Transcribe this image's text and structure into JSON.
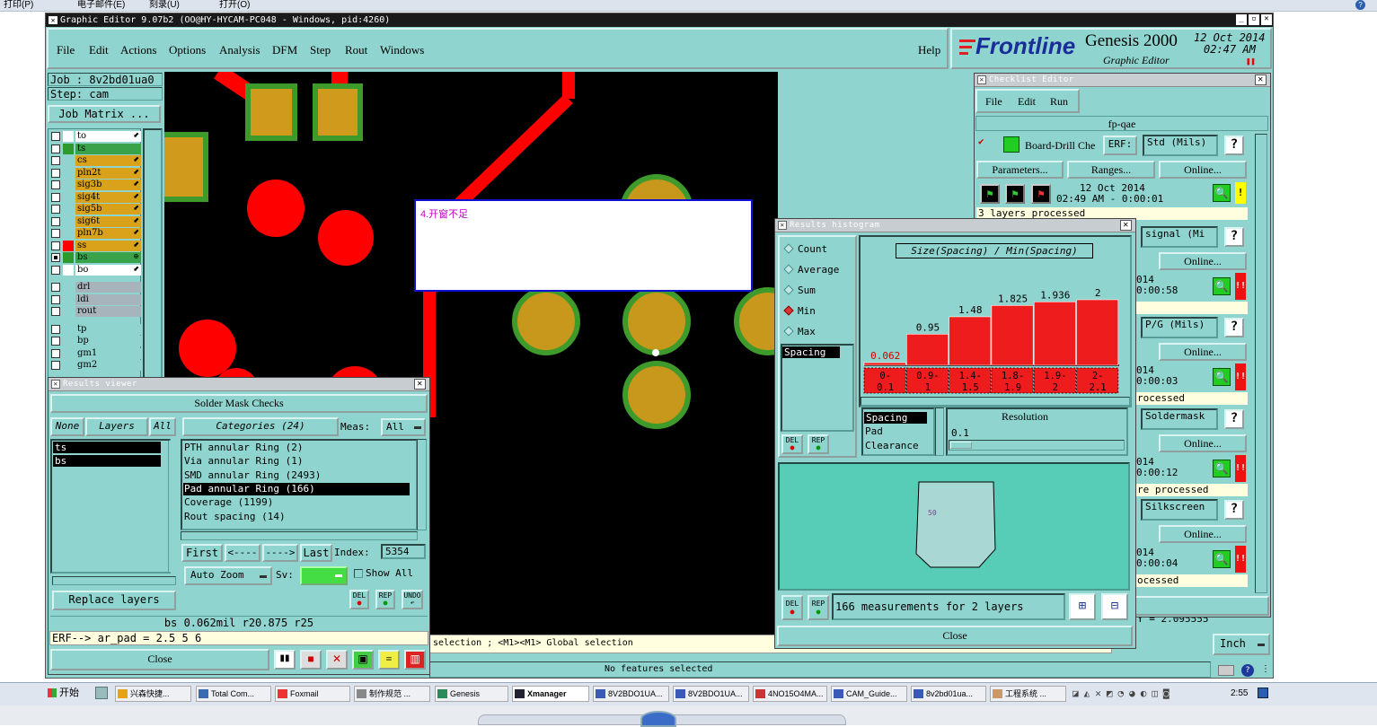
{
  "topbar": {
    "left_items": [
      "打印(P)",
      "电子邮件(E)",
      "刻录(U)",
      "打开(O)"
    ]
  },
  "window": {
    "title": "Graphic Editor 9.07b2 (OO@HY-HYCAM-PC048 - Windows, pid:4260)"
  },
  "menu": [
    "File",
    "Edit",
    "Actions",
    "Options",
    "Analysis",
    "DFM",
    "Step",
    "Rout",
    "Windows"
  ],
  "help": "Help",
  "brand": {
    "logo": "Frontline",
    "product": "Genesis 2000",
    "sub": "Graphic Editor",
    "date": "12 Oct 2014",
    "time": "02:47 AM"
  },
  "job": {
    "job_line": "Job : 8v2bd01ua0",
    "step_line": "Step: cam",
    "matrix": "Job Matrix ..."
  },
  "layers": [
    {
      "name": "to",
      "color": "#ffffff",
      "swatch": "#ffffff"
    },
    {
      "name": "ts",
      "color": "#3aa24a",
      "swatch": "#2e9a2e"
    },
    {
      "name": "cs",
      "color": "#d9a21a",
      "swatch": "#8fd4cf"
    },
    {
      "name": "pln2t",
      "color": "#d9a21a",
      "swatch": "#8fd4cf"
    },
    {
      "name": "sig3b",
      "color": "#d9a21a",
      "swatch": "#8fd4cf"
    },
    {
      "name": "sig4t",
      "color": "#d9a21a",
      "swatch": "#8fd4cf"
    },
    {
      "name": "sig5b",
      "color": "#d9a21a",
      "swatch": "#8fd4cf"
    },
    {
      "name": "sig6t",
      "color": "#d9a21a",
      "swatch": "#8fd4cf"
    },
    {
      "name": "pln7b",
      "color": "#d9a21a",
      "swatch": "#8fd4cf"
    },
    {
      "name": "ss",
      "color": "#d9a21a",
      "swatch": "#ff0000"
    },
    {
      "name": "bs",
      "color": "#3aa24a",
      "swatch": "#2e9a2e"
    },
    {
      "name": "bo",
      "color": "#ffffff",
      "swatch": "#ffffff"
    },
    {
      "name": "drl",
      "color": "#a8b4bc",
      "swatch": "#8fd4cf"
    },
    {
      "name": "ldi",
      "color": "#a8b4bc",
      "swatch": "#8fd4cf"
    },
    {
      "name": "rout",
      "color": "#a8b4bc",
      "swatch": "#8fd4cf"
    },
    {
      "name": "tp",
      "color": "#8fd4cf",
      "swatch": "#8fd4cf"
    },
    {
      "name": "bp",
      "color": "#8fd4cf",
      "swatch": "#8fd4cf"
    },
    {
      "name": "gm1",
      "color": "#8fd4cf",
      "swatch": "#8fd4cf"
    },
    {
      "name": "gm2",
      "color": "#8fd4cf",
      "swatch": "#8fd4cf"
    }
  ],
  "annotation": {
    "text": "4.开窗不足"
  },
  "results_viewer": {
    "title": "Results viewer",
    "heading": "Solder Mask Checks",
    "none": "None",
    "layers": "Layers",
    "all": "All",
    "categories_label": "Categories (24)",
    "meas_label": "Meas:",
    "meas_value": "All",
    "layer_items": [
      "ts",
      "bs"
    ],
    "category_items": [
      "PTH annular Ring (2)",
      "Via annular Ring (1)",
      "SMD annular Ring (2493)",
      "Pad annular Ring (166)",
      "Coverage (1199)",
      "Rout spacing (14)"
    ],
    "selected_category": 3,
    "first": "First",
    "prev": "<----",
    "next": "---->",
    "last": "Last",
    "index_label": "Index:",
    "index_value": "5354",
    "auto_zoom": "Auto Zoom",
    "sv": "Sv:",
    "show_all": "Show All",
    "replace_layers": "Replace layers",
    "del": "DEL",
    "rep": "REP",
    "undo": "UNDO",
    "status": "bs 0.062mil    r20.875  r25",
    "erf": "ERF--> ar_pad = 2.5 5 6",
    "close": "Close"
  },
  "checklist": {
    "title": "Checklist Editor",
    "menu": [
      "File",
      "Edit",
      "Run"
    ],
    "name": "fp-qae",
    "erf_label": "ERF:",
    "rows": [
      {
        "name": "Board-Drill Che",
        "erf": "Std (Mils)",
        "date": "12 Oct 2014",
        "time": "02:49 AM - 0:00:01",
        "status": "3 layers processed",
        "flag": "!"
      },
      {
        "erf": "signal (Mi",
        "date": "014",
        "time": "0:00:58",
        "status": "",
        "flag": "!!"
      },
      {
        "erf": "P/G (Mils)",
        "date": "014",
        "time": "0:00:03",
        "status": "rocessed",
        "flag": "!!"
      },
      {
        "erf": "Soldermask",
        "date": "014",
        "time": "0:00:12",
        "status": "re processed",
        "flag": "!!"
      },
      {
        "erf": "Silkscreen",
        "date": "014",
        "time": "0:00:04",
        "status": "ocessed",
        "flag": "!!"
      }
    ],
    "parameters": "Parameters...",
    "ranges": "Ranges...",
    "online": "Online...",
    "q": "?",
    "bottom_partial": "Y = 2.095555",
    "units": "Inch"
  },
  "histogram": {
    "title": "Results histogram",
    "options": [
      "Count",
      "Average",
      "Sum",
      "Min",
      "Max"
    ],
    "selected_option": "Min",
    "list_item": "Spacing",
    "heading": "Size(Spacing) / Min(Spacing)",
    "list2": [
      "Spacing",
      "Pad",
      "Clearance"
    ],
    "resolution_label": "Resolution",
    "resolution_value": "0.1",
    "summary": "166 measurements for 2 layers",
    "preview_label": "50",
    "close": "Close",
    "del": "DEL",
    "rep": "REP"
  },
  "chart_data": {
    "type": "bar",
    "title": "Size(Spacing) / Min(Spacing)",
    "categories": [
      "0-0.1",
      "0.9-1",
      "1.4-1.5",
      "1.8-1.9",
      "1.9-2",
      "2-2.1"
    ],
    "values": [
      0.062,
      0.95,
      1.48,
      1.825,
      1.936,
      2
    ],
    "value_labels": [
      "0.062",
      "0.95",
      "1.48",
      "1.825",
      "1.936",
      "2"
    ],
    "category_labels": [
      [
        "0-",
        "0.1"
      ],
      [
        "0.9-",
        "1"
      ],
      [
        "1.4-",
        "1.5"
      ],
      [
        "1.8-",
        "1.9"
      ],
      [
        "1.9-",
        "2"
      ],
      [
        "2-",
        "2.1"
      ]
    ],
    "ylim": [
      0,
      2.3
    ],
    "colors": {
      "bar": "#ee1c1c",
      "label_first": "#cc0000"
    }
  },
  "status": {
    "left_hint": "selection ; <M1><M1> Global selection",
    "center": "No features selected"
  },
  "taskbar": {
    "start": "开始",
    "items": [
      "兴森快捷...",
      "Total Com...",
      "Foxmail",
      "制作规范 ...",
      "Genesis",
      "Xmanager",
      "8V2BDO1UA...",
      "8V2BDO1UA...",
      "4NO15O4MA...",
      "CAM_Guide...",
      "8v2bd01ua...",
      "工程系统 ..."
    ],
    "clock": "2:55"
  }
}
